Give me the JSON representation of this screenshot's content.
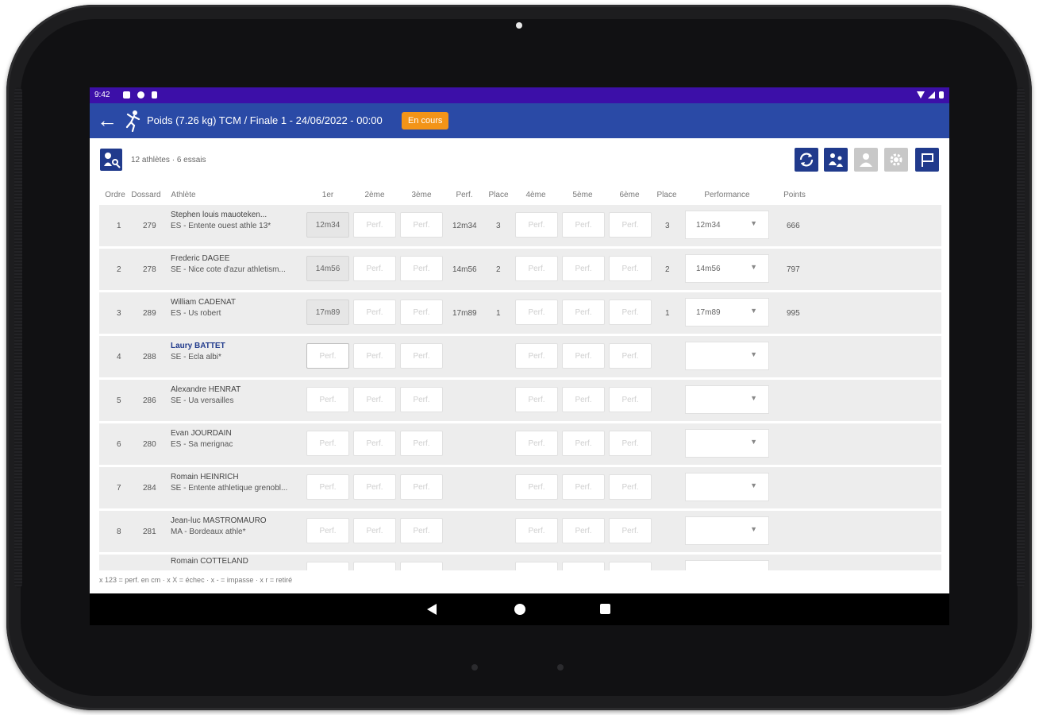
{
  "status_bar": {
    "time": "9:42"
  },
  "app_bar": {
    "title": "Poids (7.26 kg) TCM / Finale 1 - 24/06/2022 - 00:00",
    "status_badge": "En cours"
  },
  "info": {
    "summary": "12 athlètes · 6 essais"
  },
  "headers": {
    "order": "Ordre",
    "bib": "Dossard",
    "athlete": "Athlète",
    "t1": "1er",
    "t2": "2ème",
    "t3": "3ème",
    "perf": "Perf.",
    "place": "Place",
    "t4": "4ème",
    "t5": "5ème",
    "t6": "6ème",
    "place2": "Place",
    "performance": "Performance",
    "points": "Points"
  },
  "placeholder": "Perf.",
  "rows": [
    {
      "order": "1",
      "bib": "279",
      "name": "Stephen louis mauoteken...",
      "club": "ES - Entente ouest athle 13*",
      "t1": "12m34",
      "perf": "12m34",
      "place": "3",
      "place2": "3",
      "performance": "12m34",
      "points": "666"
    },
    {
      "order": "2",
      "bib": "278",
      "name": "Frederic DAGEE",
      "club": "SE - Nice cote d'azur athletism...",
      "t1": "14m56",
      "perf": "14m56",
      "place": "2",
      "place2": "2",
      "performance": "14m56",
      "points": "797"
    },
    {
      "order": "3",
      "bib": "289",
      "name": "William CADENAT",
      "club": "ES - Us robert",
      "t1": "17m89",
      "perf": "17m89",
      "place": "1",
      "place2": "1",
      "performance": "17m89",
      "points": "995"
    },
    {
      "order": "4",
      "bib": "288",
      "name": "Laury BATTET",
      "club": "SE - Ecla albi*",
      "t1": "",
      "perf": "",
      "place": "",
      "place2": "",
      "performance": "",
      "points": "",
      "active": true
    },
    {
      "order": "5",
      "bib": "286",
      "name": "Alexandre HENRAT",
      "club": "SE - Ua versailles",
      "t1": "",
      "perf": "",
      "place": "",
      "place2": "",
      "performance": "",
      "points": ""
    },
    {
      "order": "6",
      "bib": "280",
      "name": "Evan JOURDAIN",
      "club": "ES - Sa merignac",
      "t1": "",
      "perf": "",
      "place": "",
      "place2": "",
      "performance": "",
      "points": ""
    },
    {
      "order": "7",
      "bib": "284",
      "name": "Romain HEINRICH",
      "club": "SE - Entente athletique grenobl...",
      "t1": "",
      "perf": "",
      "place": "",
      "place2": "",
      "performance": "",
      "points": ""
    },
    {
      "order": "8",
      "bib": "281",
      "name": "Jean-luc MASTROMAURO",
      "club": "MA - Bordeaux athle*",
      "t1": "",
      "perf": "",
      "place": "",
      "place2": "",
      "performance": "",
      "points": ""
    },
    {
      "order": "",
      "bib": "",
      "name": "Romain COTTELAND",
      "club": "",
      "t1": "",
      "perf": "",
      "place": "",
      "place2": "",
      "performance": "",
      "points": ""
    }
  ],
  "legend": "x 123 = perf. en cm · x X = échec · x - = impasse · x r = retiré",
  "colors": {
    "status_bar": "#3c0fa8",
    "app_bar": "#2a4aa6",
    "badge": "#f39418",
    "icon_button": "#203a8c"
  },
  "icons": [
    "arrow-back-icon",
    "shot-put-athlete-icon",
    "refresh-icon",
    "swap-athletes-icon",
    "person-icon",
    "gear-icon",
    "flag-icon"
  ]
}
